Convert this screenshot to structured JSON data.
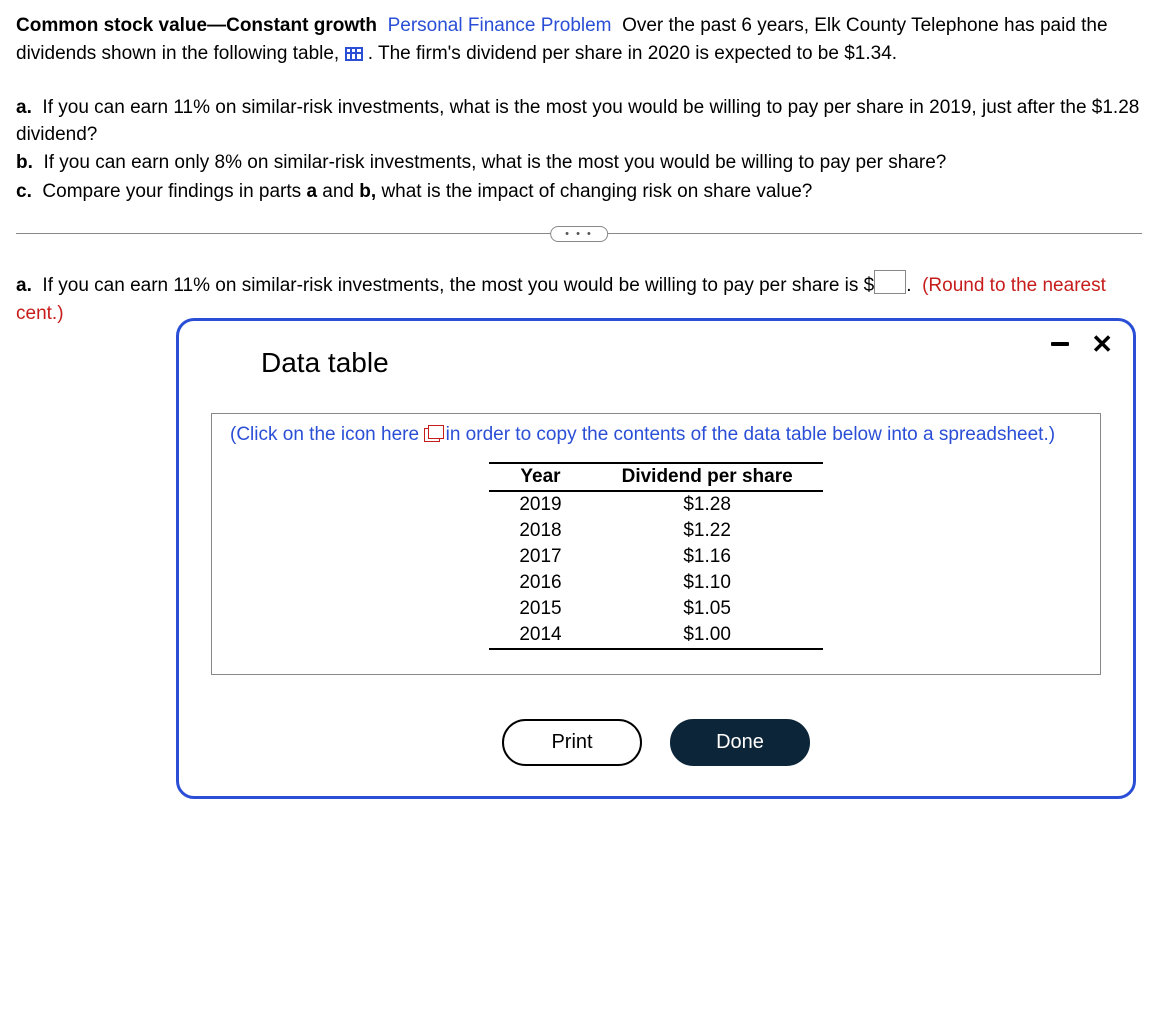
{
  "problem": {
    "title_bold": "Common stock value",
    "dash": "—",
    "subtitle_bold": "Constant growth",
    "tag": "Personal Finance Problem",
    "intro1": "Over the past 6 years, Elk County Telephone has paid the dividends shown in the following table,",
    "intro2": ". The firm's dividend per share in 2020 is expected to be $1.34.",
    "qa_label": "a.",
    "qa_text": "If you can earn 11% on similar-risk investments, what is the most you would be willing to pay per share in 2019, just after the $1.28 dividend?",
    "qb_label": "b.",
    "qb_text": "If you can earn only 8% on similar-risk investments, what is the most you would be willing to pay per share?",
    "qc_label": "c.",
    "qc_text_pre": "Compare your findings in parts ",
    "qc_a": "a",
    "qc_and": " and ",
    "qc_b": "b,",
    "qc_text_post": " what is the impact of changing risk on share value?"
  },
  "pill": "• • •",
  "answer": {
    "label": "a.",
    "text_pre": "If you can earn 11% on similar-risk investments, the most you would be willing to pay per share is $",
    "text_post": ".",
    "hint": "(Round to the nearest cent.)"
  },
  "modal": {
    "title": "Data table",
    "instruction_pre": "(Click on the icon here ",
    "instruction_post": " in order to copy the contents of the data table below into a spreadsheet.)",
    "table": {
      "col1": "Year",
      "col2": "Dividend per share",
      "rows": [
        {
          "year": "2019",
          "div": "$1.28"
        },
        {
          "year": "2018",
          "div": "$1.22"
        },
        {
          "year": "2017",
          "div": "$1.16"
        },
        {
          "year": "2016",
          "div": "$1.10"
        },
        {
          "year": "2015",
          "div": "$1.05"
        },
        {
          "year": "2014",
          "div": "$1.00"
        }
      ]
    },
    "print": "Print",
    "done": "Done"
  }
}
